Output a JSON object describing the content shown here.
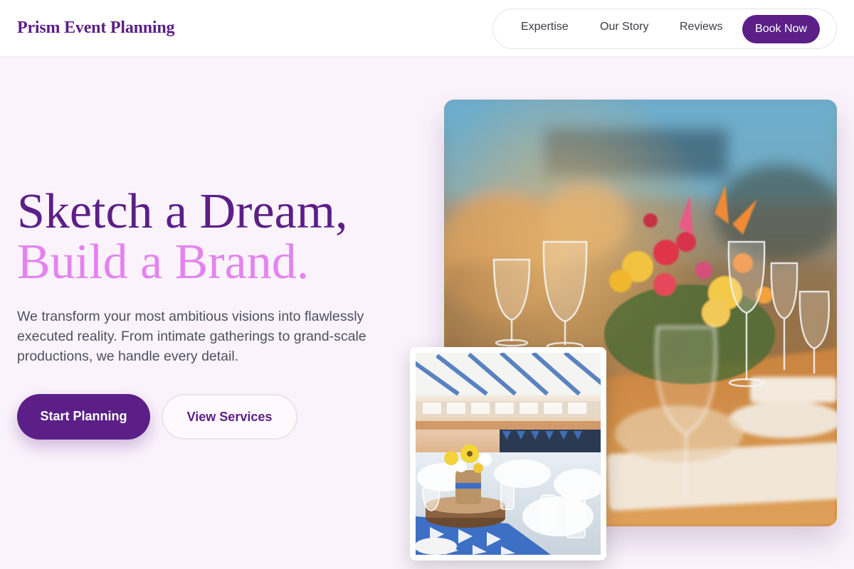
{
  "header": {
    "brand": "Prism Event Planning",
    "nav": {
      "expertise": "Expertise",
      "our_story": "Our Story",
      "reviews": "Reviews",
      "book_now": "Book Now"
    }
  },
  "hero": {
    "headline_line1": "Sketch a Dream,",
    "headline_line2": "Build a Brand.",
    "subtitle": "We transform your most ambitious visions into flawlessly executed reality. From intimate gatherings to grand-scale productions, we handle every detail.",
    "primary_cta": "Start Planning",
    "secondary_cta": "View Services"
  },
  "images": {
    "main": "table-setting-photo",
    "secondary": "banquet-hall-photo"
  },
  "colors": {
    "brand": "#5b1f87",
    "accent": "#e384ee",
    "background": "#fbf3fc"
  }
}
